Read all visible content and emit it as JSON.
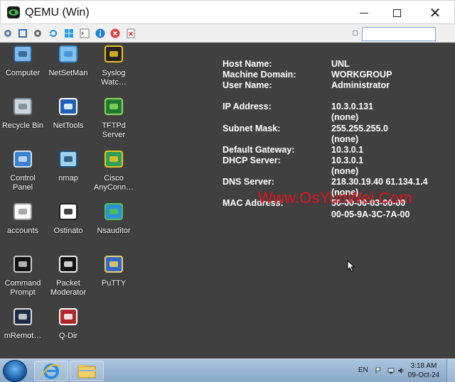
{
  "window": {
    "title": "QEMU (Win)",
    "icon": "qemu-eye-icon",
    "controls": [
      "minimize-icon",
      "maximize-icon",
      "close-icon"
    ]
  },
  "toolbar": {
    "icons": [
      "settings-gear-icon",
      "fullscreen-icon",
      "gear-icon",
      "refresh-icon",
      "windows-icon",
      "console-icon",
      "info-icon",
      "stop-icon",
      "eject-icon"
    ],
    "search_value": ""
  },
  "desktop": {
    "background_color": "#404040",
    "icons": [
      {
        "label": "Computer",
        "icon": "computer-icon"
      },
      {
        "label": "NetSetMan",
        "icon": "globe-monitor-icon"
      },
      {
        "label": "Syslog\nWatc…",
        "icon": "spy-icon"
      },
      {
        "label": "Recycle Bin",
        "icon": "recycle-bin-icon"
      },
      {
        "label": "NetTools",
        "icon": "nettools-icon"
      },
      {
        "label": "TFTPd\nServer",
        "icon": "tftpd-icon"
      },
      {
        "label": "Control\nPanel",
        "icon": "control-panel-icon"
      },
      {
        "label": "nmap",
        "icon": "eye-icon"
      },
      {
        "label": "Cisco\nAnyConn…",
        "icon": "lock-globe-icon"
      },
      {
        "label": "accounts",
        "icon": "document-icon"
      },
      {
        "label": "Ostinato",
        "icon": "ostinato-icon"
      },
      {
        "label": "Nsauditor",
        "icon": "nsauditor-icon"
      },
      {
        "label": "Command\nPrompt",
        "icon": "command-prompt-icon"
      },
      {
        "label": "Packet\nModerator",
        "icon": "packet-moderator-icon"
      },
      {
        "label": "PuTTY",
        "icon": "putty-icon"
      },
      {
        "label": "mRemot…",
        "icon": "mremote-icon"
      },
      {
        "label": "Q-Dir",
        "icon": "qdir-icon"
      }
    ]
  },
  "sysinfo": {
    "rows": [
      {
        "label": "Host Name:",
        "value": "UNL"
      },
      {
        "label": "Machine Domain:",
        "value": "WORKGROUP"
      },
      {
        "label": "User Name:",
        "value": "Administrator"
      },
      {
        "label": "IP Address:",
        "value": "10.3.0.131"
      },
      {
        "label": "",
        "value": "(none)"
      },
      {
        "label": "Subnet Mask:",
        "value": "255.255.255.0"
      },
      {
        "label": "",
        "value": "(none)"
      },
      {
        "label": "Default Gateway:",
        "value": "10.3.0.1"
      },
      {
        "label": "DHCP Server:",
        "value": "10.3.0.1"
      },
      {
        "label": "",
        "value": "(none)"
      },
      {
        "label": "DNS Server:",
        "value": "218.30.19.40 61.134.1.4"
      },
      {
        "label": "",
        "value": "(none)"
      },
      {
        "label": "MAC Address:",
        "value": "50-00-00-03-00-00"
      },
      {
        "label": "",
        "value": "00-05-9A-3C-7A-00"
      }
    ]
  },
  "watermark": "Www.OsYunWei.Com",
  "watermark_color": "#e4141b",
  "taskbar": {
    "apps": [
      "start-orb-icon",
      "internet-explorer-icon",
      "file-explorer-icon"
    ],
    "language": "EN",
    "tray_icons": [
      "flag-icon",
      "network-icon",
      "volume-icon"
    ],
    "time": "3:18 AM",
    "date": "09-Oct-24"
  }
}
